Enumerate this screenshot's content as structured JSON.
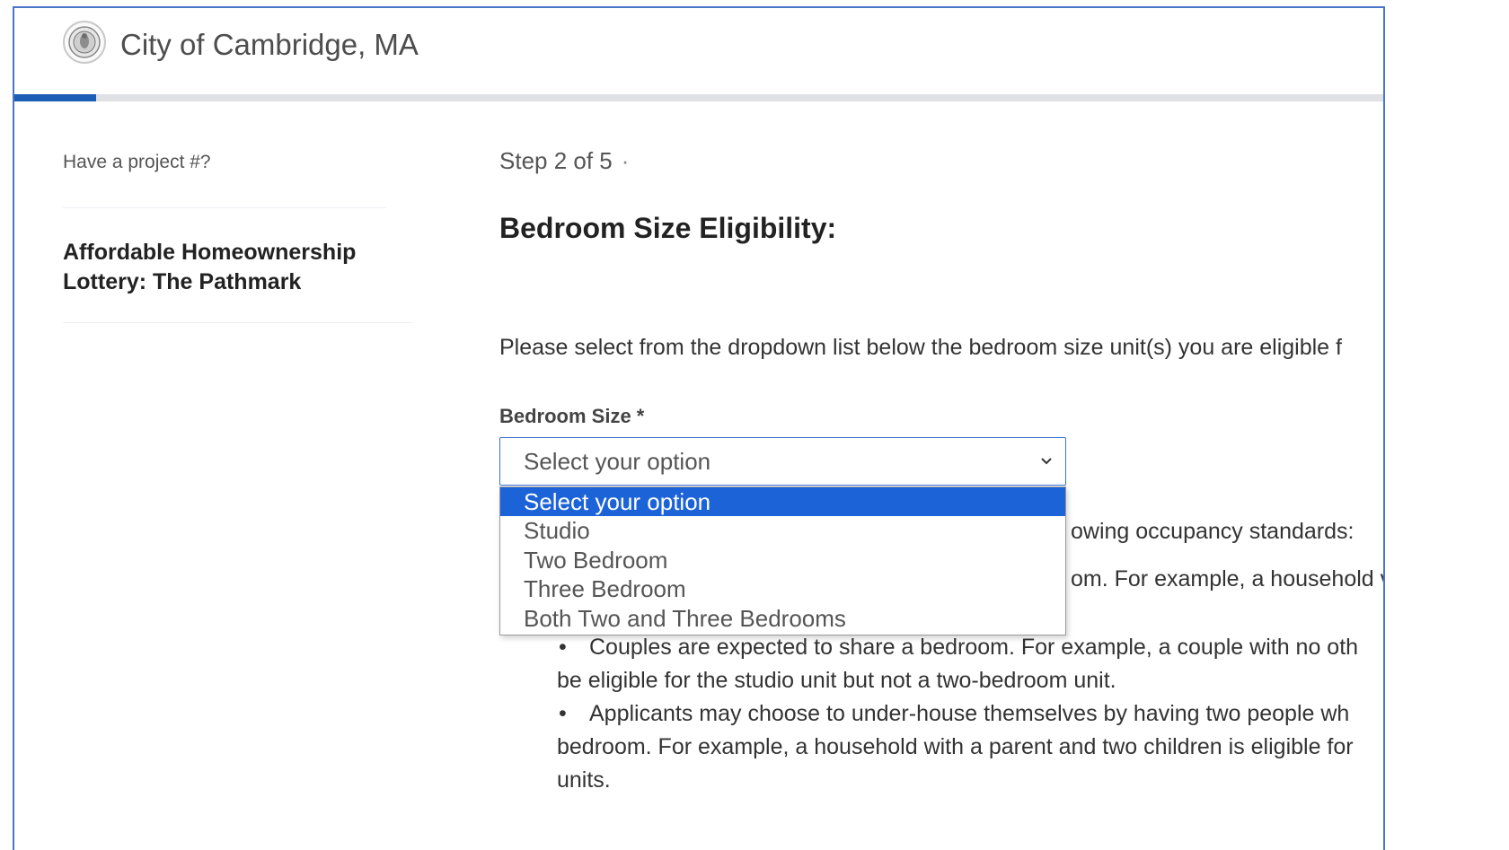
{
  "header": {
    "site_title": "City of Cambridge, MA",
    "logo_icon": "city-seal-icon",
    "progress_percent": 6,
    "progress_color": "#1e5db5"
  },
  "sidebar": {
    "project_link": "Have a project #?",
    "lottery_title": "Affordable Homeownership Lottery: The Pathmark"
  },
  "main": {
    "step": "Step 2 of 5",
    "step_dot": "·",
    "heading": "Bedroom Size Eligibility:",
    "intro": "Please select from the dropdown list below the bedroom size unit(s) you are eligible f",
    "field_label": "Bedroom Size *",
    "select_value": "Select your option",
    "select_icon": "chevron-down-icon",
    "dropdown_options": [
      "Select your option",
      "Studio",
      "Two Bedroom",
      "Three Bedroom",
      "Both Two and Three Bedrooms"
    ],
    "body_lines": {
      "occupancy": "owing occupancy standards:",
      "example": "om. For example, a household v",
      "bullet1_line1": "Couples are expected to share a bedroom. For example, a couple with no oth",
      "bullet1_line2": "be eligible for the studio unit but not a two-bedroom unit.",
      "bullet2_line1": "Applicants may choose to under-house themselves by having two people wh",
      "bullet2_line2": "bedroom. For example, a household with a parent and two children is eligible for",
      "bullet2_line3": "units."
    },
    "bullet_glyph": "•"
  }
}
